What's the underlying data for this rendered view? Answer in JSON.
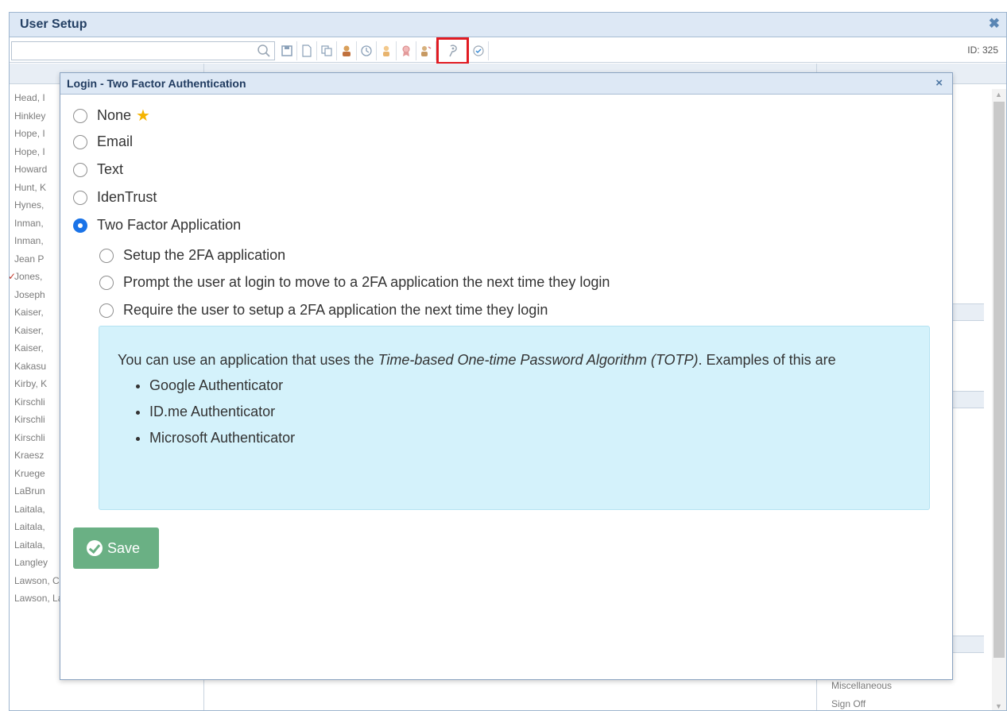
{
  "window": {
    "title": "User Setup",
    "close_glyph": "✖",
    "id_label": "ID: 325"
  },
  "toolbar": {
    "search_value": "",
    "icons": [
      "search-icon",
      "save-icon",
      "new-document-icon",
      "copy-icon",
      "user-icon",
      "clock-icon",
      "person-icon",
      "award-icon",
      "badge-icon",
      "two-factor-key-icon",
      "checkmark-icon"
    ],
    "selected_icon": "two-factor-key-icon"
  },
  "user_list": [
    {
      "name": "Head, I",
      "checked": false
    },
    {
      "name": "Hinkley",
      "checked": false
    },
    {
      "name": "Hope, I",
      "checked": false
    },
    {
      "name": "Hope, I",
      "checked": false
    },
    {
      "name": "Howard",
      "checked": false
    },
    {
      "name": "Hunt, K",
      "checked": false
    },
    {
      "name": "Hynes,",
      "checked": false
    },
    {
      "name": "Inman,",
      "checked": false
    },
    {
      "name": "Inman,",
      "checked": false
    },
    {
      "name": "Jean P",
      "checked": false
    },
    {
      "name": "Jones,",
      "checked": true
    },
    {
      "name": "Joseph",
      "checked": false
    },
    {
      "name": "Kaiser,",
      "checked": false
    },
    {
      "name": "Kaiser,",
      "checked": false
    },
    {
      "name": "Kaiser,",
      "checked": false
    },
    {
      "name": "Kakasu",
      "checked": false
    },
    {
      "name": "Kirby, K",
      "checked": false
    },
    {
      "name": "Kirschli",
      "checked": false
    },
    {
      "name": "Kirschli",
      "checked": false
    },
    {
      "name": "Kirschli",
      "checked": false
    },
    {
      "name": "Kraesz",
      "checked": false
    },
    {
      "name": "Kruege",
      "checked": false
    },
    {
      "name": "LaBrun",
      "checked": false
    },
    {
      "name": "Laitala,",
      "checked": false
    },
    {
      "name": "Laitala,",
      "checked": false
    },
    {
      "name": "Laitala,",
      "checked": false
    },
    {
      "name": "Langley",
      "checked": false
    },
    {
      "name": "Lawson, Chris",
      "checked": false
    },
    {
      "name": "Lawson, Lane",
      "checked": false
    }
  ],
  "right_column": {
    "item_1": "Miscellaneous",
    "item_2": "Sign Off"
  },
  "colors": {
    "accent": "#1a73e8",
    "save": "#6ab084",
    "info_bg": "#d4f2fb",
    "highlight": "#e11b22"
  },
  "modal": {
    "title": "Login - Two Factor Authentication",
    "close_glyph": "×",
    "options": {
      "none": "None",
      "email": "Email",
      "text": "Text",
      "identrust": "IdenTrust",
      "two_factor_app": "Two Factor Application"
    },
    "selected": "two_factor_app",
    "sub_options": {
      "setup": "Setup the 2FA application",
      "prompt": "Prompt the user at login to move to a 2FA application the next time they login",
      "require": "Require the user to setup a 2FA application the next time they login"
    },
    "info": {
      "intro_before": "You can use an application that uses the ",
      "intro_em": "Time-based One-time Password Algorithm (TOTP)",
      "intro_after": ". Examples of this are",
      "examples": [
        "Google Authenticator",
        "ID.me Authenticator",
        "Microsoft Authenticator"
      ]
    },
    "save_label": "Save"
  }
}
